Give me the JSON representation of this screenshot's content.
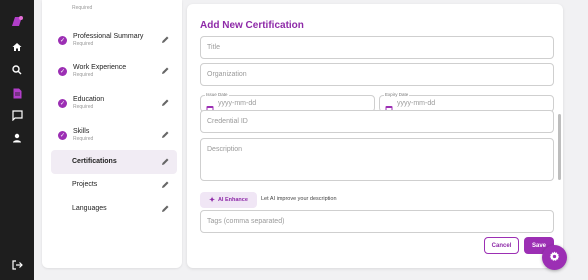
{
  "sidebar": {
    "cut_sub": "Required",
    "sections": [
      {
        "label": "Professional Summary",
        "sub": "Required"
      },
      {
        "label": "Work Experience",
        "sub": "Required"
      },
      {
        "label": "Education",
        "sub": "Required"
      },
      {
        "label": "Skills",
        "sub": "Required"
      },
      {
        "label": "Certifications",
        "sub": ""
      },
      {
        "label": "Projects",
        "sub": ""
      },
      {
        "label": "Languages",
        "sub": ""
      }
    ]
  },
  "form": {
    "title": "Add New Certification",
    "title_placeholder": "Title",
    "organization_placeholder": "Organization",
    "issue_date_label": "Issue Date",
    "issue_date_placeholder": "yyyy-mm-dd",
    "expiry_date_label": "Expiry Date",
    "expiry_date_placeholder": "yyyy-mm-dd",
    "credential_placeholder": "Credential ID",
    "description_placeholder": "Description",
    "ai_enhance_label": "AI Enhance",
    "ai_hint": "Let AI improve your description",
    "tags_placeholder": "Tags (comma separated)",
    "cancel_label": "Cancel",
    "save_label": "Save"
  },
  "colors": {
    "accent": "#9c2fb4",
    "rail": "#1e1e1e"
  },
  "icons": {
    "rail": [
      "logo-icon",
      "home-icon",
      "search-icon",
      "document-icon",
      "chat-icon",
      "user-icon",
      "logout-icon"
    ],
    "fab": "gear-icon"
  }
}
